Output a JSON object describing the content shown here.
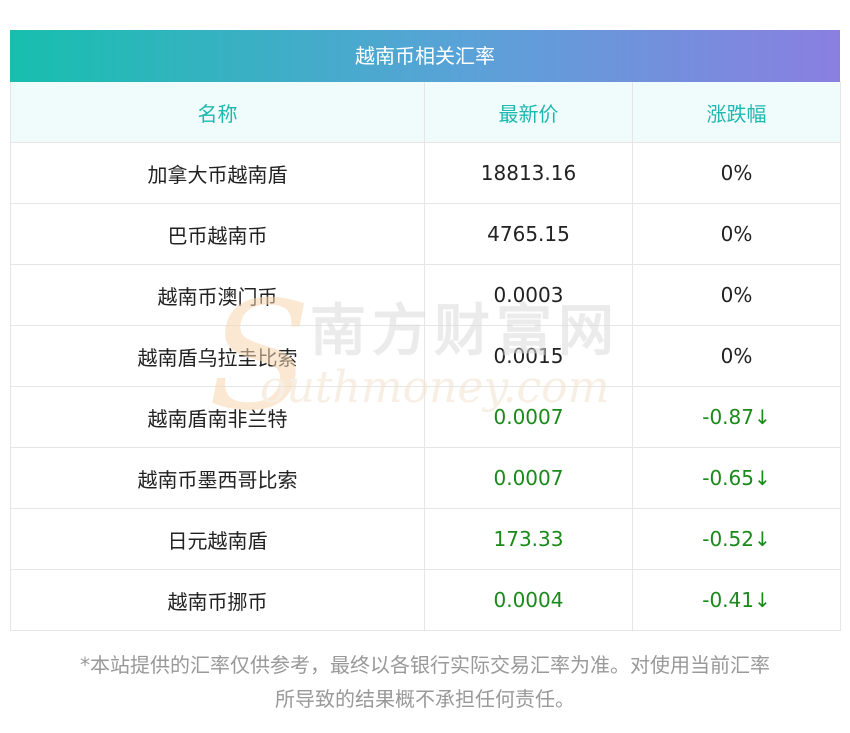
{
  "title": "越南币相关汇率",
  "columns": [
    "名称",
    "最新价",
    "涨跌幅"
  ],
  "rows": [
    {
      "name": "加拿大币越南盾",
      "price": "18813.16",
      "change": "0%",
      "trend": "flat"
    },
    {
      "name": "巴币越南币",
      "price": "4765.15",
      "change": "0%",
      "trend": "flat"
    },
    {
      "name": "越南币澳门币",
      "price": "0.0003",
      "change": "0%",
      "trend": "flat"
    },
    {
      "name": "越南盾乌拉圭比索",
      "price": "0.0015",
      "change": "0%",
      "trend": "flat"
    },
    {
      "name": "越南盾南非兰特",
      "price": "0.0007",
      "change": "-0.87↓",
      "trend": "down"
    },
    {
      "name": "越南币墨西哥比索",
      "price": "0.0007",
      "change": "-0.65↓",
      "trend": "down"
    },
    {
      "name": "日元越南盾",
      "price": "173.33",
      "change": "-0.52↓",
      "trend": "down"
    },
    {
      "name": "越南币挪币",
      "price": "0.0004",
      "change": "-0.41↓",
      "trend": "down"
    }
  ],
  "footnote": {
    "line1": "*本站提供的汇率仅供参考，最终以各银行实际交易汇率为准。对使用当前汇率",
    "line2": "所导致的结果概不承担任何责任。"
  },
  "watermark": {
    "cn": "南方财富网",
    "en": "outhmoney.com",
    "initial": "S"
  },
  "colors": {
    "header_gradient_start": "#17bfae",
    "header_gradient_end": "#8a7fe0",
    "column_header_text": "#1eb8b0",
    "down": "#1a8a1a",
    "neutral": "#222222"
  }
}
